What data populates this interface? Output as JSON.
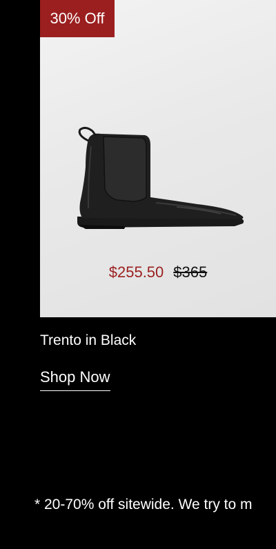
{
  "product": {
    "badge": "30% Off",
    "image_icon": "chelsea-boot-icon",
    "price_sale": "$255.50",
    "price_original": "$365",
    "title": "Trento in Black",
    "cta": "Shop Now"
  },
  "footer": {
    "disclaimer": "* 20-70% off sitewide. We try to m"
  },
  "colors": {
    "background": "#000000",
    "badge": "#9b1f1f",
    "sale_price": "#9b1f1f",
    "card": "#ececec"
  }
}
